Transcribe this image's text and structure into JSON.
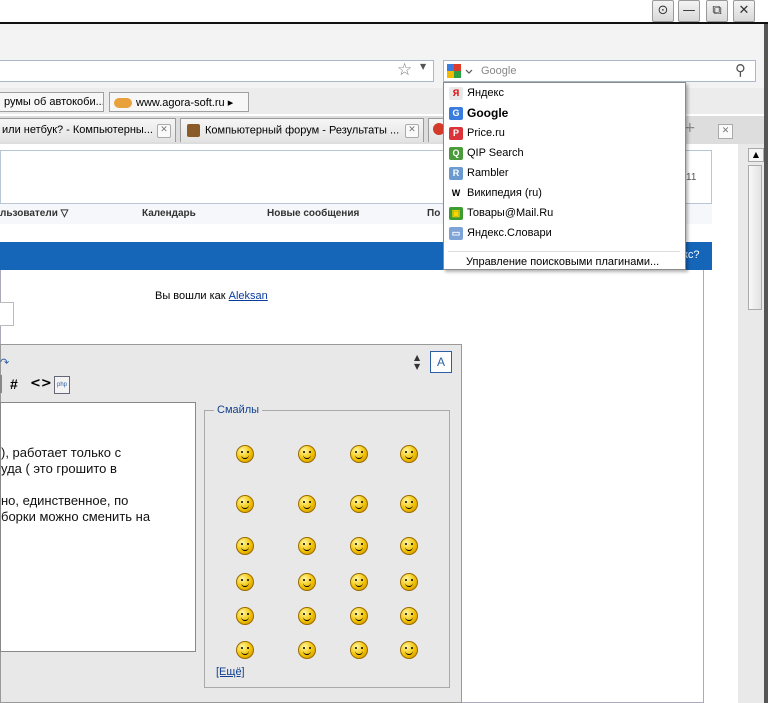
{
  "window": {
    "buttons": [
      "⊙",
      "—",
      "⧉",
      "✕"
    ]
  },
  "search": {
    "placeholder": "Google"
  },
  "bookmarks": [
    {
      "label": "румы об автокоби..."
    },
    {
      "label": "www.agora-soft.ru ▸"
    }
  ],
  "tabs": [
    {
      "label": "или нетбук? - Компьютерны..."
    },
    {
      "label": "Компьютерный форум - Результаты ..."
    }
  ],
  "forum": {
    "nav": [
      "льзователи ▽",
      "Календарь",
      "Новые сообщения",
      "По"
    ],
    "logged_in_prefix": "Вы вошли как",
    "username": "Aleksan",
    "bluebar_text": "кс?",
    "stray_text": "11"
  },
  "editor": {
    "toolbar_icons": "# <>",
    "font_button": "A",
    "lines": [
      "), работает только с",
      "уда ( это грошито в",
      "",
      "но, единственное, по",
      "борки можно сменить на"
    ],
    "smiles_title": "Смайлы",
    "more_link": "[Ещё]"
  },
  "search_dropdown": {
    "engines": [
      {
        "label": "Яндекс",
        "icon": "yandex-icon",
        "color": "#e8e8e8",
        "glyph": "Я",
        "glyphColor": "#d00",
        "bold": false
      },
      {
        "label": "Google",
        "icon": "google-icon",
        "color": "#3a7de0",
        "glyph": "G",
        "glyphColor": "#fff",
        "bold": true
      },
      {
        "label": "Price.ru",
        "icon": "price-ru-icon",
        "color": "#d9343a",
        "glyph": "P",
        "glyphColor": "#fff",
        "bold": false
      },
      {
        "label": "QIP Search",
        "icon": "qip-icon",
        "color": "#4a9b3a",
        "glyph": "Q",
        "glyphColor": "#fff",
        "bold": false
      },
      {
        "label": "Rambler",
        "icon": "rambler-icon",
        "color": "#6a9ad0",
        "glyph": "R",
        "glyphColor": "#fff",
        "bold": false
      },
      {
        "label": "Википедия (ru)",
        "icon": "wikipedia-icon",
        "color": "#ffffff",
        "glyph": "W",
        "glyphColor": "#000",
        "bold": false
      },
      {
        "label": "Товары@Mail.Ru",
        "icon": "mailru-goods-icon",
        "color": "#3d9c2f",
        "glyph": "▣",
        "glyphColor": "#ffd400",
        "bold": false
      },
      {
        "label": "Яндекс.Словари",
        "icon": "yandex-dictionary-icon",
        "color": "#7ea3d6",
        "glyph": "▭",
        "glyphColor": "#fff",
        "bold": false
      }
    ],
    "manage_label": "Управление поисковыми плагинами..."
  }
}
